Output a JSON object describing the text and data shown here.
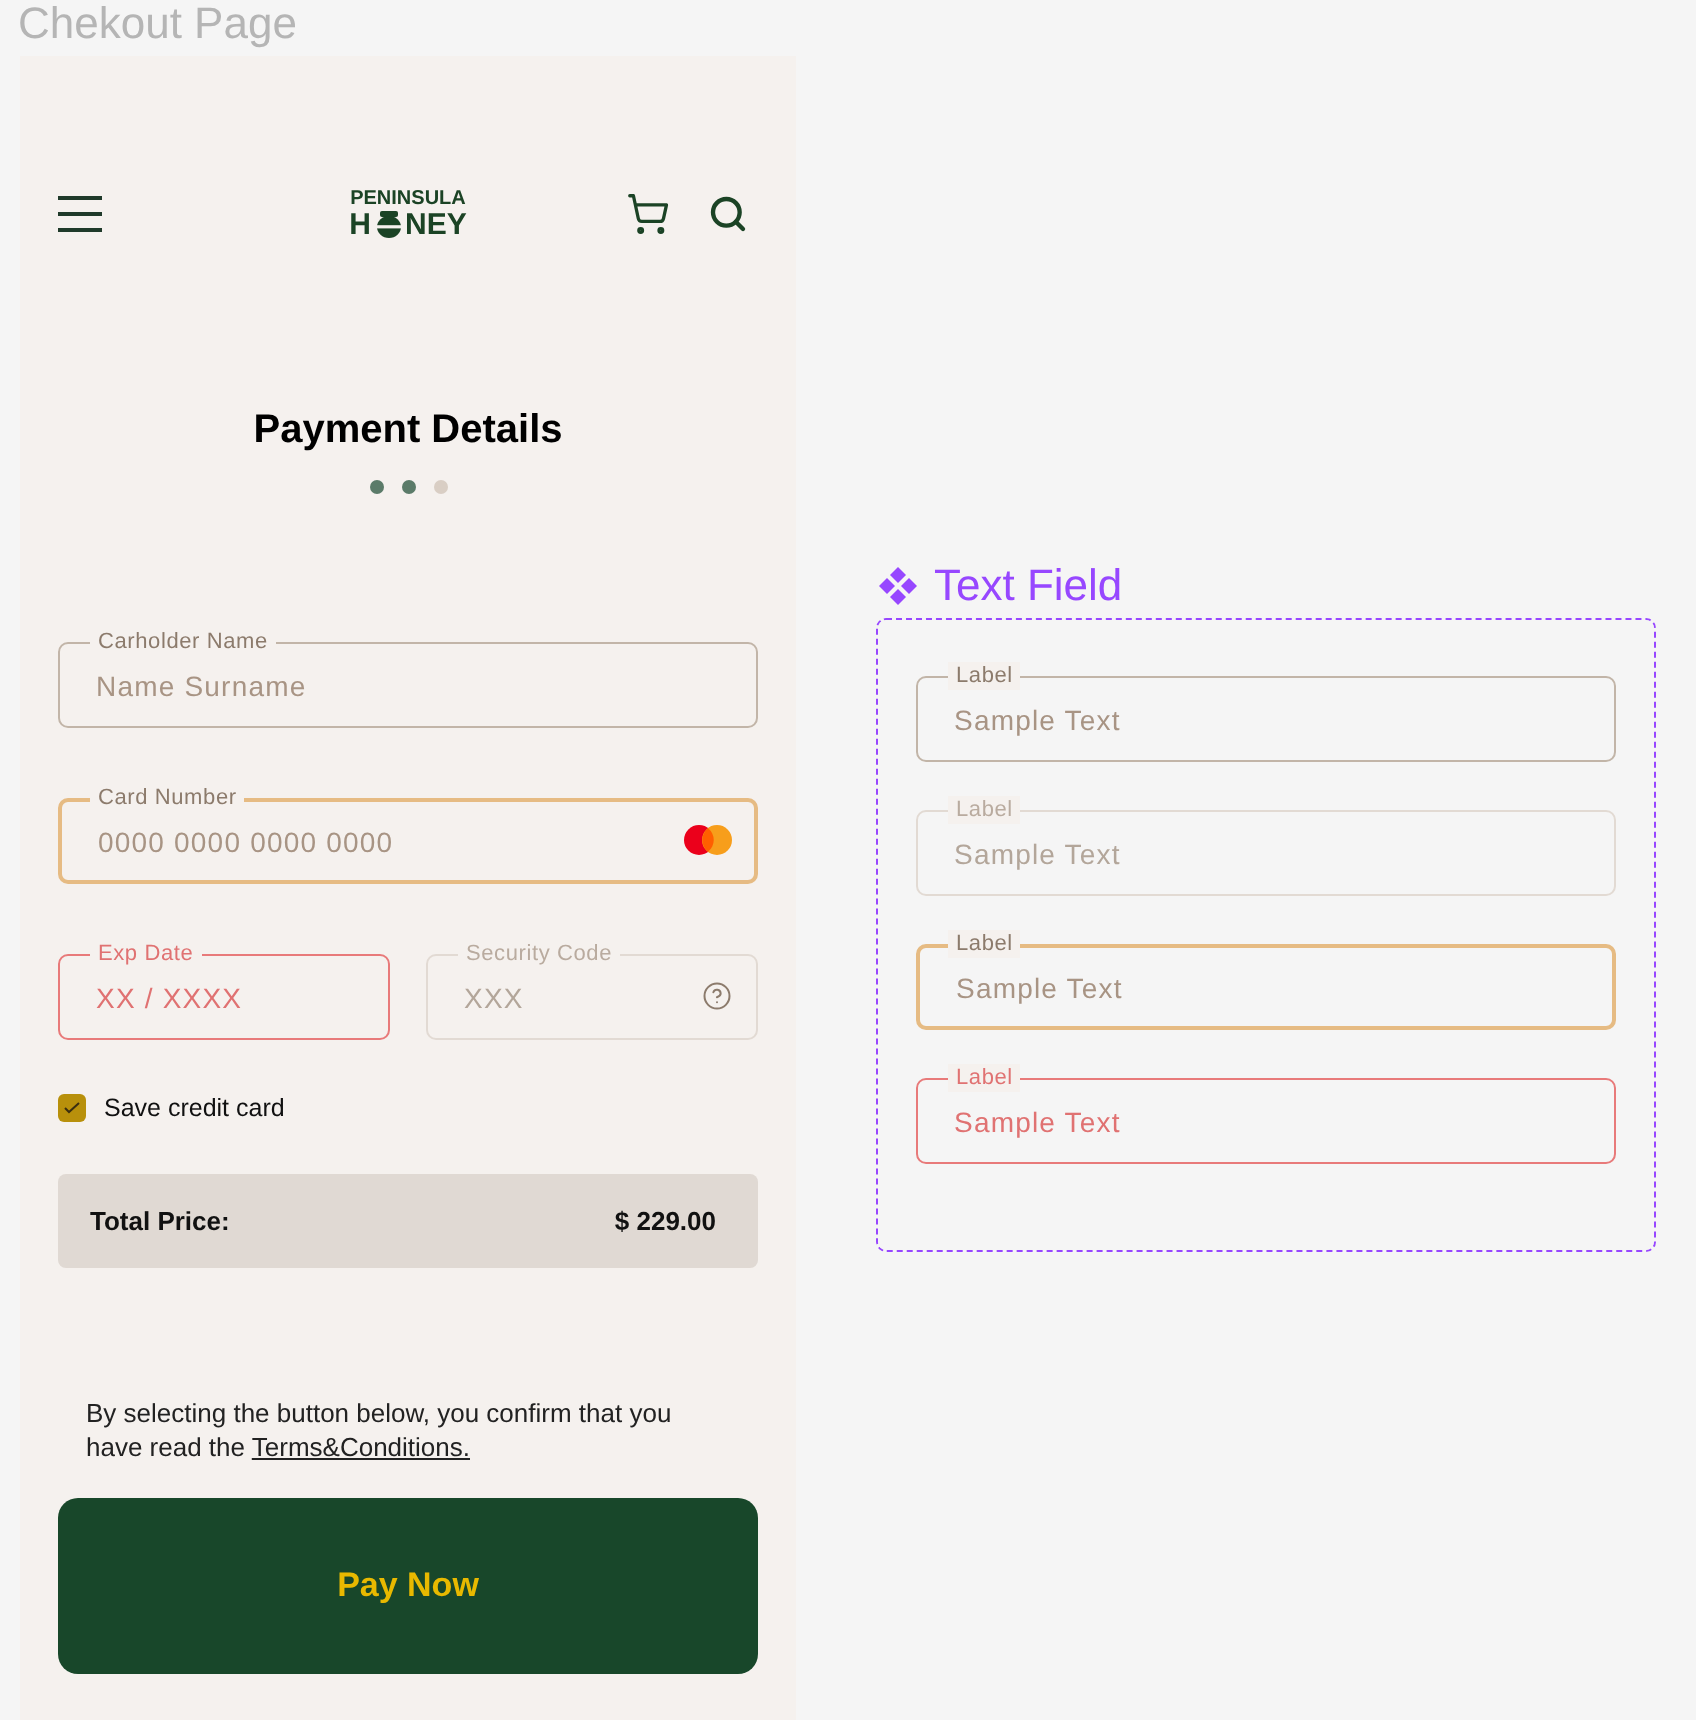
{
  "canvas": {
    "frame_title": "Chekout Page"
  },
  "header": {
    "logo": {
      "top": "PENINSULA",
      "bottom_start": "H",
      "bottom_end": "NEY"
    }
  },
  "title": "Payment Details",
  "steps": [
    {
      "active": true
    },
    {
      "active": true
    },
    {
      "active": false
    }
  ],
  "form_rows": [
    {
      "fields": [
        {
          "label": "Carholder Name",
          "placeholder": "Name Surname",
          "focused": false,
          "error": false,
          "disabled": false
        }
      ]
    },
    {
      "fields": [
        {
          "kind": "card",
          "label": "Card Number",
          "placeholder": "0000 0000 0000 0000",
          "focused": true,
          "error": false,
          "disabled": false
        }
      ]
    },
    {
      "fields": [
        {
          "label": "Exp Date",
          "placeholder": "XX / XXXX",
          "focused": false,
          "error": true,
          "disabled": false
        },
        {
          "kind": "help",
          "label": "Security Code",
          "placeholder": "XXX",
          "focused": false,
          "error": false,
          "disabled": true
        }
      ]
    }
  ],
  "save_card": {
    "label": "Save credit card",
    "checked": true
  },
  "total": {
    "label": "Total Price:",
    "amount": "$ 229.00"
  },
  "notice": {
    "text": "By selecting the button below, you confirm that you have read the ",
    "link": "Terms&Conditions."
  },
  "pay_button": "Pay Now",
  "component_panel": {
    "title": "Text Field",
    "variants": [
      {
        "label": "Label",
        "placeholder": "Sample Text",
        "focused": false,
        "error": false,
        "disabled": false
      },
      {
        "label": "Label",
        "placeholder": "Sample Text",
        "focused": false,
        "error": false,
        "disabled": true
      },
      {
        "label": "Label",
        "placeholder": "Sample Text",
        "focused": true,
        "error": false,
        "disabled": false
      },
      {
        "label": "Label",
        "placeholder": "Sample Text",
        "focused": false,
        "error": true,
        "disabled": false
      }
    ]
  }
}
